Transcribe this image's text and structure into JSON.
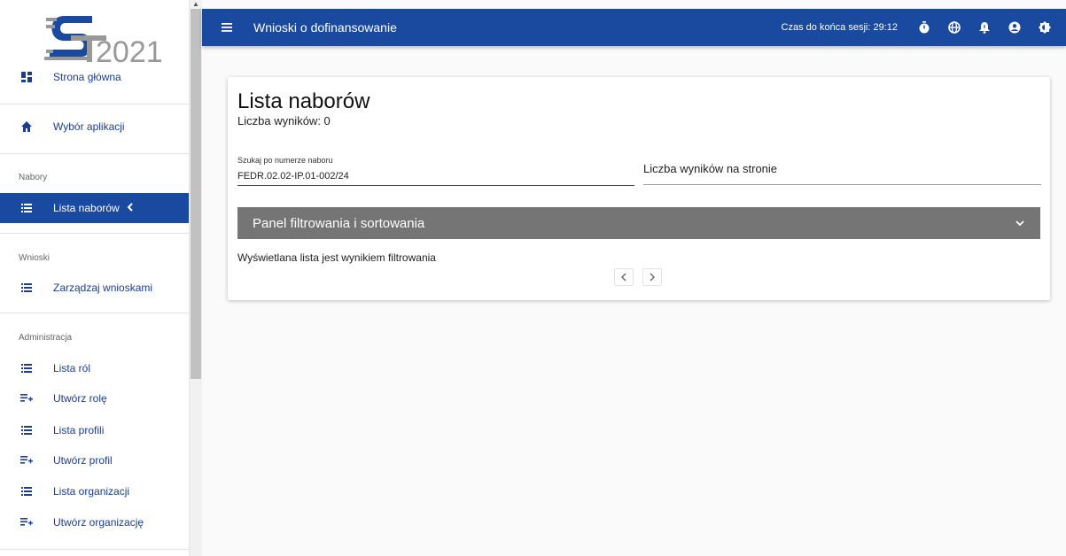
{
  "logo": {
    "text": "2021",
    "color": "#1a4aa0"
  },
  "sidebar": {
    "items": [
      {
        "label": "Strona główna",
        "icon": "dashboard-icon"
      },
      {
        "label": "Wybór aplikacji",
        "icon": "home-icon"
      }
    ],
    "sections": [
      {
        "label": "Nabory",
        "items": [
          {
            "label": "Lista naborów",
            "icon": "list-icon",
            "active": true
          }
        ]
      },
      {
        "label": "Wnioski",
        "items": [
          {
            "label": "Zarządzaj wnioskami",
            "icon": "list-icon"
          }
        ]
      },
      {
        "label": "Administracja",
        "items": [
          {
            "label": "Lista ról",
            "icon": "list-icon"
          },
          {
            "label": "Utwórz rolę",
            "icon": "playlist-add-icon"
          },
          {
            "label": "Lista profili",
            "icon": "list-icon"
          },
          {
            "label": "Utwórz profil",
            "icon": "playlist-add-icon"
          },
          {
            "label": "Lista organizacji",
            "icon": "list-icon"
          },
          {
            "label": "Utwórz organizację",
            "icon": "playlist-add-icon"
          }
        ]
      }
    ]
  },
  "topbar": {
    "title": "Wnioski o dofinansowanie",
    "session_text": "Czas do końca sesji: 29:12",
    "icons": [
      "timer-icon",
      "globe-icon",
      "bell-icon",
      "account-icon",
      "contrast-icon"
    ],
    "color": "#1a4aa0"
  },
  "main": {
    "title": "Lista naborów",
    "result_count": "Liczba wyników: 0",
    "search": {
      "label": "Szukaj po numerze naboru",
      "value": "FEDR.02.02-IP.01-002/24"
    },
    "per_page_label": "Liczba wyników na stronie",
    "filter_panel": {
      "label": "Panel filtrowania i sortowania",
      "color": "#757575"
    },
    "filter_note": "Wyświetlana lista jest wynikiem filtrowania"
  }
}
